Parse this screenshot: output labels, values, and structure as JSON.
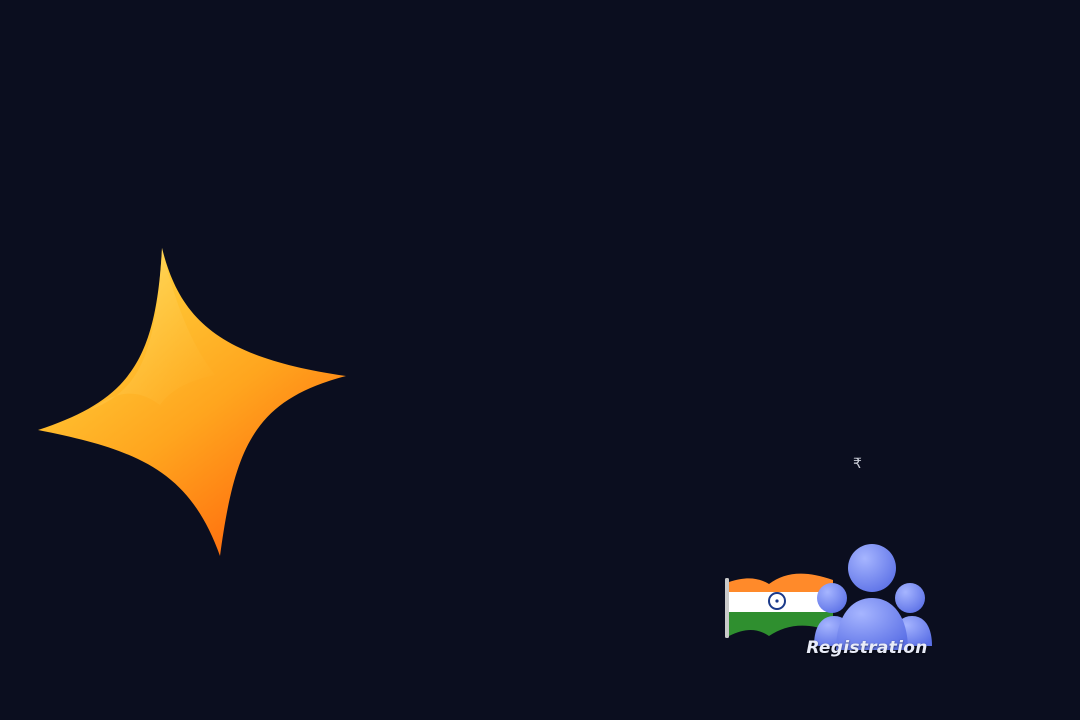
{
  "badge": {
    "currency_symbol": "₹",
    "label": "Registration"
  },
  "colors": {
    "background": "#0b0e1f",
    "sparkle_light": "#ffcc3a",
    "sparkle_dark": "#ff7a12",
    "people": "#6f86f2",
    "flag_saffron": "#ff8a2a",
    "flag_white": "#ffffff",
    "flag_green": "#2f8f2f",
    "flag_chakra": "#1b3a8a"
  },
  "icons": {
    "sparkle": "sparkle-star-icon",
    "flag": "india-flag-icon",
    "people": "people-group-icon"
  }
}
